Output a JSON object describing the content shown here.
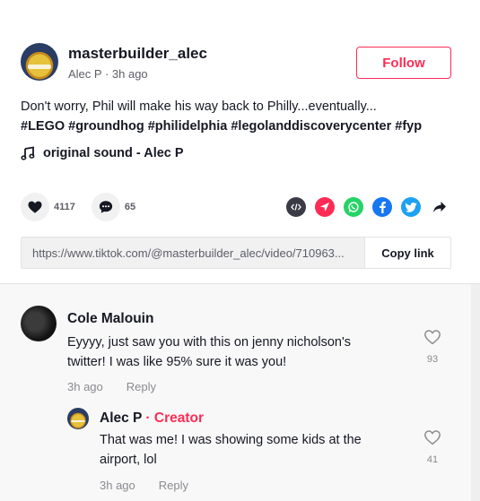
{
  "post": {
    "username": "masterbuilder_alec",
    "meta": "Alec P · 3h ago",
    "follow_label": "Follow",
    "caption": "Don't worry, Phil will make his way back to Philly...eventually...",
    "hashtags": [
      "#LEGO",
      "#groundhog",
      "#philidelphia",
      "#legolanddiscoverycenter",
      "#fyp"
    ],
    "sound": "original sound - Alec P"
  },
  "actions": {
    "likes": "4117",
    "comments": "65"
  },
  "share_icons": [
    "embed-icon",
    "send-icon",
    "whatsapp-icon",
    "facebook-icon",
    "twitter-icon",
    "share-arrow-icon"
  ],
  "link": {
    "url": "https://www.tiktok.com/@masterbuilder_alec/video/710963...",
    "copy_label": "Copy link"
  },
  "comments": [
    {
      "name": "Cole Malouin",
      "text": "Eyyyy, just saw you with this on jenny nicholson's twitter! I was like 95% sure it was you!",
      "time": "3h ago",
      "reply_label": "Reply",
      "likes": "93"
    }
  ],
  "reply": {
    "name": "Alec P",
    "separator": " · ",
    "badge": "Creator",
    "text": "That was me! I was showing some kids at the airport, lol",
    "time": "3h ago",
    "reply_label": "Reply",
    "likes": "41"
  },
  "colors": {
    "accent": "#fe2c55",
    "text": "#161823",
    "muted": "#8a8b91",
    "whatsapp": "#25d366",
    "facebook": "#1877f2",
    "twitter": "#1da1f2",
    "embed": "#3a3b45"
  }
}
